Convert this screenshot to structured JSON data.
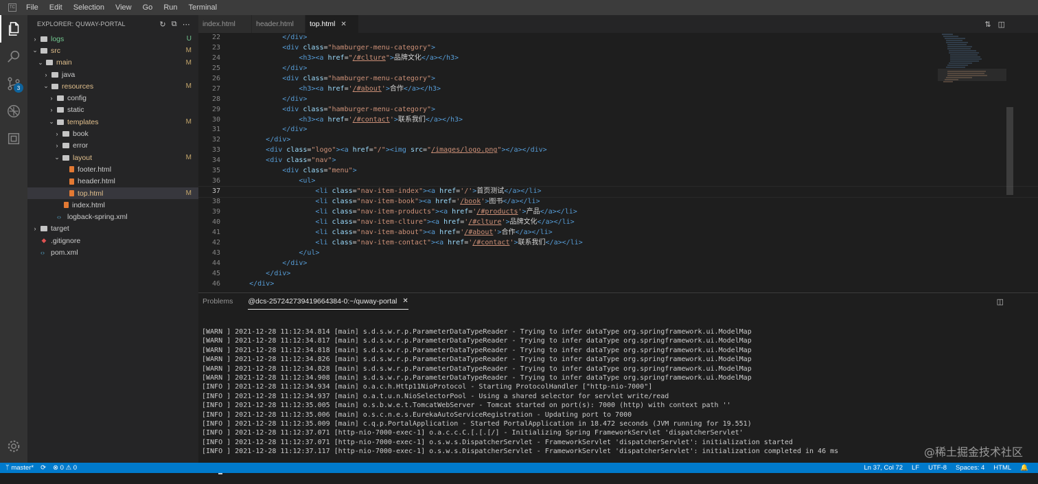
{
  "app": {
    "logo": "TC",
    "menu": [
      "File",
      "Edit",
      "Selection",
      "View",
      "Go",
      "Run",
      "Terminal"
    ]
  },
  "activity_bar": {
    "icons": [
      "files-icon",
      "search-icon",
      "source-control-icon",
      "extensions-icon",
      "remote-icon"
    ],
    "scm_badge": "3",
    "settings_icon": "gear-icon"
  },
  "explorer": {
    "title": "EXPLORER: QUWAY-PORTAL",
    "tree": [
      {
        "label": "logs",
        "type": "folder",
        "depth": 0,
        "open": false,
        "status": "U"
      },
      {
        "label": "src",
        "type": "folder",
        "depth": 0,
        "open": true,
        "status": "M"
      },
      {
        "label": "main",
        "type": "folder",
        "depth": 1,
        "open": true,
        "status": "M"
      },
      {
        "label": "java",
        "type": "folder",
        "depth": 2,
        "open": false,
        "status": ""
      },
      {
        "label": "resources",
        "type": "folder",
        "depth": 2,
        "open": true,
        "status": "M"
      },
      {
        "label": "config",
        "type": "folder",
        "depth": 3,
        "open": false,
        "status": ""
      },
      {
        "label": "static",
        "type": "folder",
        "depth": 3,
        "open": false,
        "status": ""
      },
      {
        "label": "templates",
        "type": "folder",
        "depth": 3,
        "open": true,
        "status": "M"
      },
      {
        "label": "book",
        "type": "folder",
        "depth": 4,
        "open": false,
        "status": ""
      },
      {
        "label": "error",
        "type": "folder",
        "depth": 4,
        "open": false,
        "status": ""
      },
      {
        "label": "layout",
        "type": "folder",
        "depth": 4,
        "open": true,
        "status": "M"
      },
      {
        "label": "footer.html",
        "type": "html",
        "depth": 5,
        "status": ""
      },
      {
        "label": "header.html",
        "type": "html",
        "depth": 5,
        "status": ""
      },
      {
        "label": "top.html",
        "type": "html",
        "depth": 5,
        "status": "M",
        "selected": true
      },
      {
        "label": "index.html",
        "type": "html",
        "depth": 4,
        "status": ""
      },
      {
        "label": "logback-spring.xml",
        "type": "xml",
        "depth": 3,
        "status": ""
      },
      {
        "label": "target",
        "type": "folder",
        "depth": 0,
        "open": false,
        "status": ""
      },
      {
        "label": ".gitignore",
        "type": "git",
        "depth": 0,
        "status": ""
      },
      {
        "label": "pom.xml",
        "type": "xml",
        "depth": 0,
        "status": ""
      }
    ]
  },
  "tabs": [
    {
      "label": "index.html",
      "active": false
    },
    {
      "label": "header.html",
      "active": false
    },
    {
      "label": "top.html",
      "active": true,
      "close": "✕"
    }
  ],
  "editor": {
    "current_line": 37,
    "lines": [
      {
        "n": "22",
        "indent": 12,
        "parts": [
          [
            "tag",
            "</div>"
          ]
        ]
      },
      {
        "n": "23",
        "indent": 12,
        "parts": [
          [
            "tag",
            "<div "
          ],
          [
            "attr",
            "class"
          ],
          [
            "txt",
            "="
          ],
          [
            "str",
            "\"hamburger-menu-category\""
          ],
          [
            "tag",
            ">"
          ]
        ]
      },
      {
        "n": "24",
        "indent": 16,
        "parts": [
          [
            "tag",
            "<h3><a "
          ],
          [
            "attr",
            "href"
          ],
          [
            "txt",
            "="
          ],
          [
            "str",
            "\""
          ],
          [
            "link",
            "/#clture"
          ],
          [
            "str",
            "\""
          ],
          [
            "tag",
            ">"
          ],
          [
            "txt",
            "品牌文化"
          ],
          [
            "tag",
            "</a></h3>"
          ]
        ]
      },
      {
        "n": "25",
        "indent": 12,
        "parts": [
          [
            "tag",
            "</div>"
          ]
        ]
      },
      {
        "n": "26",
        "indent": 12,
        "parts": [
          [
            "tag",
            "<div "
          ],
          [
            "attr",
            "class"
          ],
          [
            "txt",
            "="
          ],
          [
            "str",
            "\"hamburger-menu-category\""
          ],
          [
            "tag",
            ">"
          ]
        ]
      },
      {
        "n": "27",
        "indent": 16,
        "parts": [
          [
            "tag",
            "<h3><a "
          ],
          [
            "attr",
            "href"
          ],
          [
            "txt",
            "="
          ],
          [
            "str",
            "'"
          ],
          [
            "link",
            "/#about"
          ],
          [
            "str",
            "'"
          ],
          [
            "tag",
            ">"
          ],
          [
            "txt",
            "合作"
          ],
          [
            "tag",
            "</a></h3>"
          ]
        ]
      },
      {
        "n": "28",
        "indent": 12,
        "parts": [
          [
            "tag",
            "</div>"
          ]
        ]
      },
      {
        "n": "29",
        "indent": 12,
        "parts": [
          [
            "tag",
            "<div "
          ],
          [
            "attr",
            "class"
          ],
          [
            "txt",
            "="
          ],
          [
            "str",
            "\"hamburger-menu-category\""
          ],
          [
            "tag",
            ">"
          ]
        ]
      },
      {
        "n": "30",
        "indent": 16,
        "parts": [
          [
            "tag",
            "<h3><a "
          ],
          [
            "attr",
            "href"
          ],
          [
            "txt",
            "="
          ],
          [
            "str",
            "'"
          ],
          [
            "link",
            "/#contact"
          ],
          [
            "str",
            "'"
          ],
          [
            "tag",
            ">"
          ],
          [
            "txt",
            "联系我们"
          ],
          [
            "tag",
            "</a></h3>"
          ]
        ]
      },
      {
        "n": "31",
        "indent": 12,
        "parts": [
          [
            "tag",
            "</div>"
          ]
        ]
      },
      {
        "n": "32",
        "indent": 8,
        "parts": [
          [
            "tag",
            "</div>"
          ]
        ]
      },
      {
        "n": "33",
        "indent": 8,
        "parts": [
          [
            "tag",
            "<div "
          ],
          [
            "attr",
            "class"
          ],
          [
            "txt",
            "="
          ],
          [
            "str",
            "\"logo\""
          ],
          [
            "tag",
            "><a "
          ],
          [
            "attr",
            "href"
          ],
          [
            "txt",
            "="
          ],
          [
            "str",
            "\"/\""
          ],
          [
            "tag",
            "><img "
          ],
          [
            "attr",
            "src"
          ],
          [
            "txt",
            "="
          ],
          [
            "str",
            "\""
          ],
          [
            "link",
            "/images/logo.png"
          ],
          [
            "str",
            "\""
          ],
          [
            "tag",
            "></a></div>"
          ]
        ]
      },
      {
        "n": "34",
        "indent": 8,
        "parts": [
          [
            "tag",
            "<div "
          ],
          [
            "attr",
            "class"
          ],
          [
            "txt",
            "="
          ],
          [
            "str",
            "\"nav\""
          ],
          [
            "tag",
            ">"
          ]
        ]
      },
      {
        "n": "35",
        "indent": 12,
        "parts": [
          [
            "tag",
            "<div "
          ],
          [
            "attr",
            "class"
          ],
          [
            "txt",
            "="
          ],
          [
            "str",
            "\"menu\""
          ],
          [
            "tag",
            ">"
          ]
        ]
      },
      {
        "n": "36",
        "indent": 16,
        "parts": [
          [
            "tag",
            "<ul>"
          ]
        ]
      },
      {
        "n": "37",
        "indent": 20,
        "parts": [
          [
            "tag",
            "<li "
          ],
          [
            "attr",
            "class"
          ],
          [
            "txt",
            "="
          ],
          [
            "str",
            "\"nav-item-index\""
          ],
          [
            "tag",
            "><a "
          ],
          [
            "attr",
            "href"
          ],
          [
            "txt",
            "="
          ],
          [
            "str",
            "'/'"
          ],
          [
            "tag",
            ">"
          ],
          [
            "txt",
            "首页测试"
          ],
          [
            "tag",
            "</a></li>"
          ]
        ]
      },
      {
        "n": "38",
        "indent": 20,
        "parts": [
          [
            "tag",
            "<li "
          ],
          [
            "attr",
            "class"
          ],
          [
            "txt",
            "="
          ],
          [
            "str",
            "\"nav-item-book\""
          ],
          [
            "tag",
            "><a "
          ],
          [
            "attr",
            "href"
          ],
          [
            "txt",
            "="
          ],
          [
            "str",
            "'"
          ],
          [
            "link",
            "/book"
          ],
          [
            "str",
            "'"
          ],
          [
            "tag",
            ">"
          ],
          [
            "txt",
            "图书"
          ],
          [
            "tag",
            "</a></li>"
          ]
        ]
      },
      {
        "n": "39",
        "indent": 20,
        "parts": [
          [
            "tag",
            "<li "
          ],
          [
            "attr",
            "class"
          ],
          [
            "txt",
            "="
          ],
          [
            "str",
            "\"nav-item-products\""
          ],
          [
            "tag",
            "><a "
          ],
          [
            "attr",
            "href"
          ],
          [
            "txt",
            "="
          ],
          [
            "str",
            "'"
          ],
          [
            "link",
            "/#products"
          ],
          [
            "str",
            "'"
          ],
          [
            "tag",
            ">"
          ],
          [
            "txt",
            "产品"
          ],
          [
            "tag",
            "</a></li>"
          ]
        ]
      },
      {
        "n": "40",
        "indent": 20,
        "parts": [
          [
            "tag",
            "<li "
          ],
          [
            "attr",
            "class"
          ],
          [
            "txt",
            "="
          ],
          [
            "str",
            "\"nav-item-clture\""
          ],
          [
            "tag",
            "><a "
          ],
          [
            "attr",
            "href"
          ],
          [
            "txt",
            "="
          ],
          [
            "str",
            "'"
          ],
          [
            "link",
            "/#clture"
          ],
          [
            "str",
            "'"
          ],
          [
            "tag",
            ">"
          ],
          [
            "txt",
            "品牌文化"
          ],
          [
            "tag",
            "</a></li>"
          ]
        ]
      },
      {
        "n": "41",
        "indent": 20,
        "parts": [
          [
            "tag",
            "<li "
          ],
          [
            "attr",
            "class"
          ],
          [
            "txt",
            "="
          ],
          [
            "str",
            "\"nav-item-about\""
          ],
          [
            "tag",
            "><a "
          ],
          [
            "attr",
            "href"
          ],
          [
            "txt",
            "="
          ],
          [
            "str",
            "'"
          ],
          [
            "link",
            "/#about"
          ],
          [
            "str",
            "'"
          ],
          [
            "tag",
            ">"
          ],
          [
            "txt",
            "合作"
          ],
          [
            "tag",
            "</a></li>"
          ]
        ]
      },
      {
        "n": "42",
        "indent": 20,
        "parts": [
          [
            "tag",
            "<li "
          ],
          [
            "attr",
            "class"
          ],
          [
            "txt",
            "="
          ],
          [
            "str",
            "\"nav-item-contact\""
          ],
          [
            "tag",
            "><a "
          ],
          [
            "attr",
            "href"
          ],
          [
            "txt",
            "="
          ],
          [
            "str",
            "'"
          ],
          [
            "link",
            "/#contact"
          ],
          [
            "str",
            "'"
          ],
          [
            "tag",
            ">"
          ],
          [
            "txt",
            "联系我们"
          ],
          [
            "tag",
            "</a></li>"
          ]
        ]
      },
      {
        "n": "43",
        "indent": 16,
        "parts": [
          [
            "tag",
            "</ul>"
          ]
        ]
      },
      {
        "n": "44",
        "indent": 12,
        "parts": [
          [
            "tag",
            "</div>"
          ]
        ]
      },
      {
        "n": "45",
        "indent": 8,
        "parts": [
          [
            "tag",
            "</div>"
          ]
        ]
      },
      {
        "n": "46",
        "indent": 4,
        "parts": [
          [
            "tag",
            "</div>"
          ]
        ]
      }
    ]
  },
  "panel": {
    "tabs": [
      {
        "label": "Problems",
        "active": false
      },
      {
        "label": "@dcs-257242739419664384-0:~/quway-portal",
        "active": true,
        "close": "✕"
      }
    ],
    "terminal_lines": [
      "[WARN ] 2021-12-28 11:12:34.814 [main] s.d.s.w.r.p.ParameterDataTypeReader - Trying to infer dataType org.springframework.ui.ModelMap",
      "[WARN ] 2021-12-28 11:12:34.817 [main] s.d.s.w.r.p.ParameterDataTypeReader - Trying to infer dataType org.springframework.ui.ModelMap",
      "[WARN ] 2021-12-28 11:12:34.818 [main] s.d.s.w.r.p.ParameterDataTypeReader - Trying to infer dataType org.springframework.ui.ModelMap",
      "[WARN ] 2021-12-28 11:12:34.826 [main] s.d.s.w.r.p.ParameterDataTypeReader - Trying to infer dataType org.springframework.ui.ModelMap",
      "[WARN ] 2021-12-28 11:12:34.828 [main] s.d.s.w.r.p.ParameterDataTypeReader - Trying to infer dataType org.springframework.ui.ModelMap",
      "[WARN ] 2021-12-28 11:12:34.908 [main] s.d.s.w.r.p.ParameterDataTypeReader - Trying to infer dataType org.springframework.ui.ModelMap",
      "[INFO ] 2021-12-28 11:12:34.934 [main] o.a.c.h.Http11NioProtocol - Starting ProtocolHandler [\"http-nio-7000\"]",
      "[INFO ] 2021-12-28 11:12:34.937 [main] o.a.t.u.n.NioSelectorPool - Using a shared selector for servlet write/read",
      "[INFO ] 2021-12-28 11:12:35.005 [main] o.s.b.w.e.t.TomcatWebServer - Tomcat started on port(s): 7000 (http) with context path ''",
      "[INFO ] 2021-12-28 11:12:35.006 [main] o.s.c.n.e.s.EurekaAutoServiceRegistration - Updating port to 7000",
      "[INFO ] 2021-12-28 11:12:35.009 [main] c.q.p.PortalApplication - Started PortalApplication in 18.472 seconds (JVM running for 19.551)",
      "[INFO ] 2021-12-28 11:12:37.071 [http-nio-7000-exec-1] o.a.c.c.C.[.[.[/] - Initializing Spring FrameworkServlet 'dispatcherServlet'",
      "[INFO ] 2021-12-28 11:12:37.071 [http-nio-7000-exec-1] o.s.w.s.DispatcherServlet - FrameworkServlet 'dispatcherServlet': initialization started",
      "[INFO ] 2021-12-28 11:12:37.117 [http-nio-7000-exec-1] o.s.w.s.DispatcherServlet - FrameworkServlet 'dispatcherServlet': initialization completed in 46 ms"
    ]
  },
  "statusbar": {
    "branch": "master*",
    "sync": "⟳",
    "problems": "⊗ 0 ⚠ 0",
    "position": "Ln 37, Col 72",
    "eol": "LF",
    "encoding": "UTF-8",
    "spaces": "Spaces: 4",
    "language": "HTML"
  },
  "watermark": "@稀土掘金技术社区",
  "colors": {
    "accent": "#007acc",
    "tag": "#569cd6",
    "attr": "#9cdcfe",
    "string": "#ce9178",
    "modified": "#e2c08d",
    "untracked": "#73c991"
  }
}
